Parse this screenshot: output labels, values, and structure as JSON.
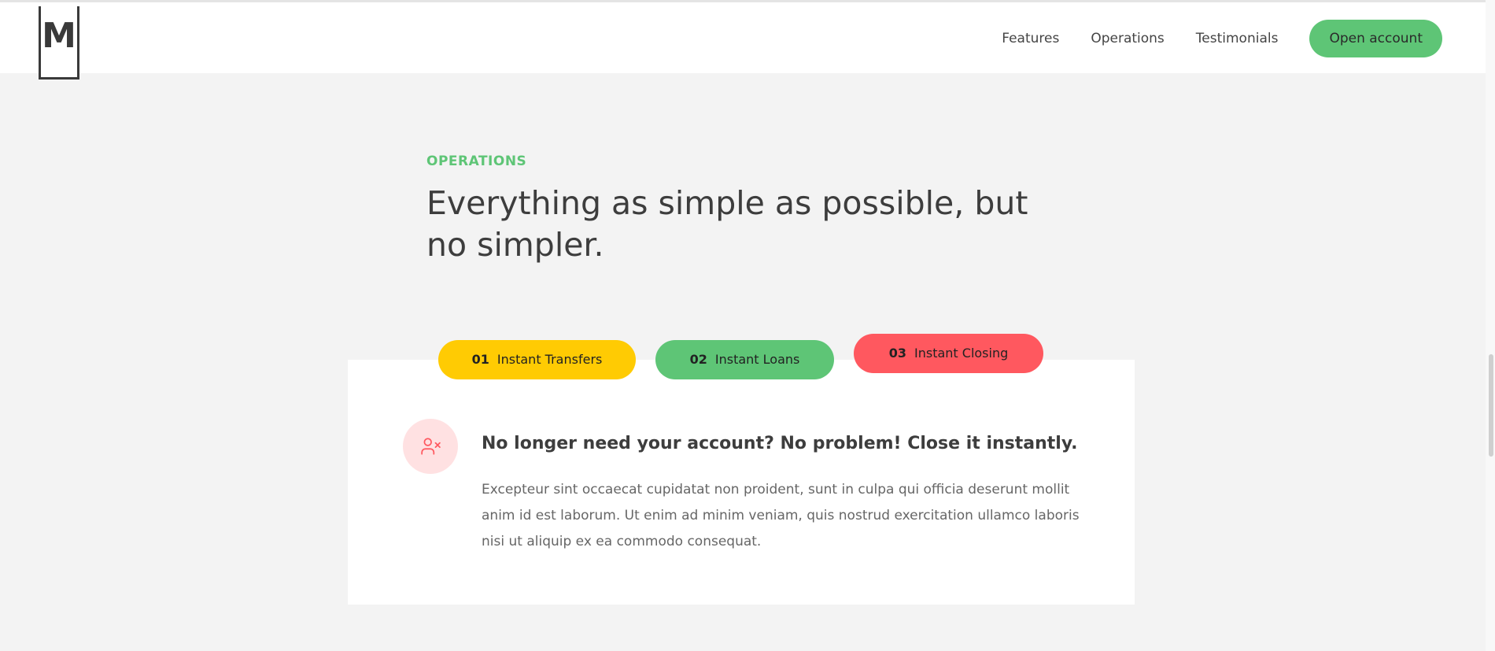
{
  "header": {
    "logo_letter": "M",
    "nav": [
      {
        "label": "Features"
      },
      {
        "label": "Operations"
      },
      {
        "label": "Testimonials"
      }
    ],
    "cta_label": "Open account"
  },
  "section": {
    "label": "OPERATIONS",
    "title": "Everything as simple as possible, but no simpler."
  },
  "tabs": [
    {
      "num": "01",
      "label": "Instant Transfers",
      "color": "#ffcb03"
    },
    {
      "num": "02",
      "label": "Instant Loans",
      "color": "#5ec576"
    },
    {
      "num": "03",
      "label": "Instant Closing",
      "color": "#ff585f",
      "active": true
    }
  ],
  "content": {
    "icon": "user-x-icon",
    "title": "No longer need your account? No problem! Close it instantly.",
    "text": "Excepteur sint occaecat cupidatat non proident, sunt in culpa qui officia deserunt mollit anim id est laborum. Ut enim ad minim veniam, quis nostrud exercitation ullamco laboris nisi ut aliquip ex ea commodo consequat."
  },
  "colors": {
    "accent_green": "#5ec576",
    "accent_yellow": "#ffcb03",
    "accent_red": "#ff585f",
    "background": "#f3f3f3"
  }
}
